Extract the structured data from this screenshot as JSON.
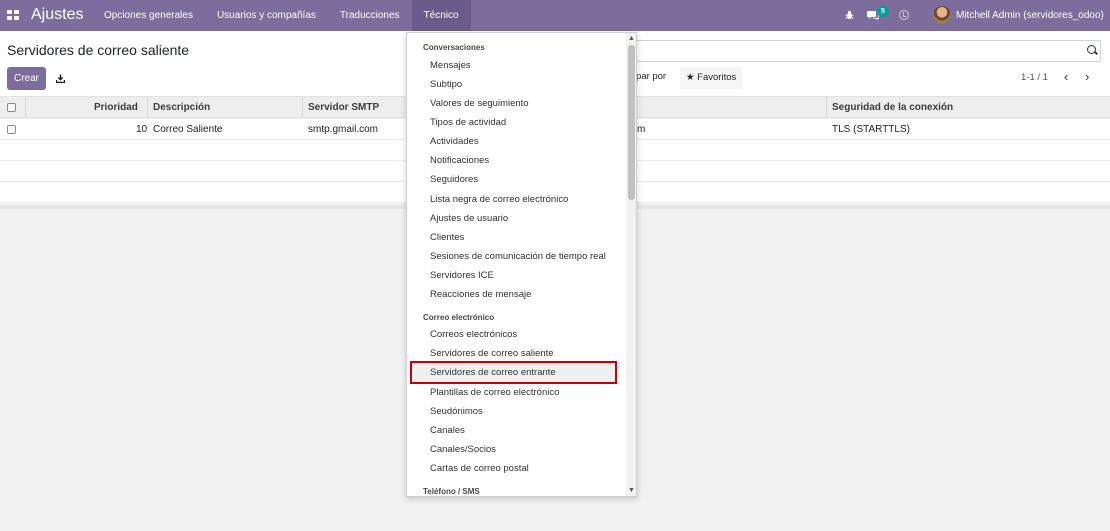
{
  "navbar": {
    "brand": "Ajustes",
    "menu": [
      "Opciones generales",
      "Usuarios y compañías",
      "Traducciones",
      "Técnico"
    ],
    "chat_count": "5",
    "user": "Mitchell Admin (servidores_odoo)"
  },
  "control_panel": {
    "title": "Servidores de correo saliente",
    "create_label": "Crear",
    "groupby_label": "par por",
    "favorites_label": "Favoritos",
    "pager": "1-1 / 1"
  },
  "table": {
    "columns": [
      "Prioridad",
      "Descripción",
      "Servidor SMTP",
      "Seguridad de la conexión"
    ],
    "rows": [
      {
        "priority": "10",
        "description": "Correo Saliente",
        "server": "smtp.gmail.com",
        "username_fragment": "m",
        "security": "TLS (STARTTLS)"
      }
    ]
  },
  "dropdown": {
    "section_conversaciones": "Conversaciones",
    "conversaciones": [
      "Mensajes",
      "Subtipo",
      "Valores de seguimiento",
      "Tipos de actividad",
      "Actividades",
      "Notificaciones",
      "Seguidores",
      "Lista negra de correo electrónico",
      "Ajustes de usuario",
      "Clientes",
      "Sesiones de comunicación de tiempo real",
      "Servidores ICE",
      "Reacciones de mensaje"
    ],
    "section_correo": "Correo electrónico",
    "correo": [
      "Correos electrónicos",
      "Servidores de correo saliente",
      "Servidores de correo entrante",
      "Plantillas de correo electrónico",
      "Seudónimos",
      "Canales",
      "Canales/Socios",
      "Cartas de correo postal"
    ],
    "section_telefono": "Teléfono / SMS",
    "highlight_color": "#c30010"
  },
  "colors": {
    "navbar": "#7c6d9c",
    "primary_button": "#7c6d9c",
    "badge": "#00a09d"
  }
}
